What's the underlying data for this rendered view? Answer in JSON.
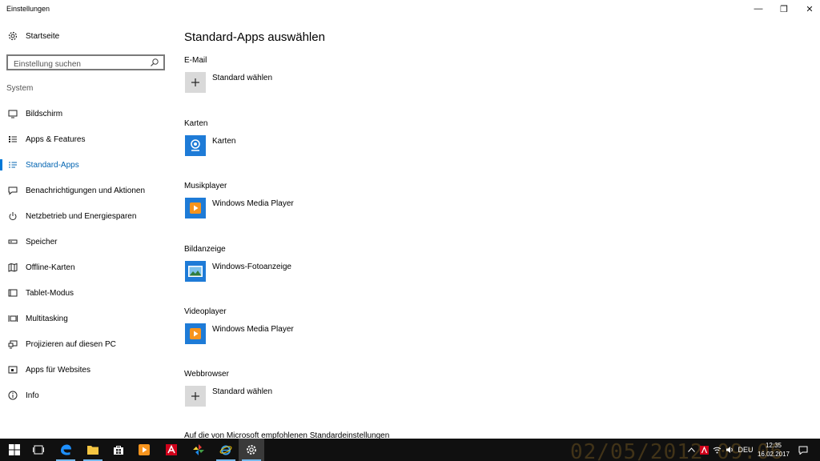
{
  "window": {
    "title": "Einstellungen",
    "minimize_glyph": "—",
    "maximize_glyph": "❐",
    "close_glyph": "✕"
  },
  "sidebar": {
    "home_label": "Startseite",
    "search_placeholder": "Einstellung suchen",
    "group_label": "System",
    "items": [
      {
        "label": "Bildschirm",
        "icon": "monitor-icon"
      },
      {
        "label": "Apps & Features",
        "icon": "list-icon"
      },
      {
        "label": "Standard-Apps",
        "icon": "default-apps-icon",
        "active": true
      },
      {
        "label": "Benachrichtigungen und Aktionen",
        "icon": "message-icon"
      },
      {
        "label": "Netzbetrieb und Energiesparen",
        "icon": "power-icon"
      },
      {
        "label": "Speicher",
        "icon": "storage-icon"
      },
      {
        "label": "Offline-Karten",
        "icon": "map-icon"
      },
      {
        "label": "Tablet-Modus",
        "icon": "tablet-icon"
      },
      {
        "label": "Multitasking",
        "icon": "multitasking-icon"
      },
      {
        "label": "Projizieren auf diesen PC",
        "icon": "project-icon"
      },
      {
        "label": "Apps für Websites",
        "icon": "apps-websites-icon"
      },
      {
        "label": "Info",
        "icon": "info-icon"
      }
    ]
  },
  "main": {
    "title": "Standard-Apps auswählen",
    "sections": [
      {
        "label": "E-Mail",
        "app": "Standard wählen",
        "icon": "plus-icon"
      },
      {
        "label": "Karten",
        "app": "Karten",
        "icon": "maps-app-icon"
      },
      {
        "label": "Musikplayer",
        "app": "Windows Media Player",
        "icon": "media-player-icon"
      },
      {
        "label": "Bildanzeige",
        "app": "Windows-Fotoanzeige",
        "icon": "photo-viewer-icon"
      },
      {
        "label": "Videoplayer",
        "app": "Windows Media Player",
        "icon": "media-player-icon"
      },
      {
        "label": "Webbrowser",
        "app": "Standard wählen",
        "icon": "plus-icon"
      }
    ],
    "footer_text": "Auf die von Microsoft empfohlenen Standardeinstellungen"
  },
  "taskbar": {
    "watermark": "02/05/2012 09:06",
    "language": "DEU",
    "time": "12:35",
    "date": "16.02.2017",
    "accent": "#0078d7"
  }
}
